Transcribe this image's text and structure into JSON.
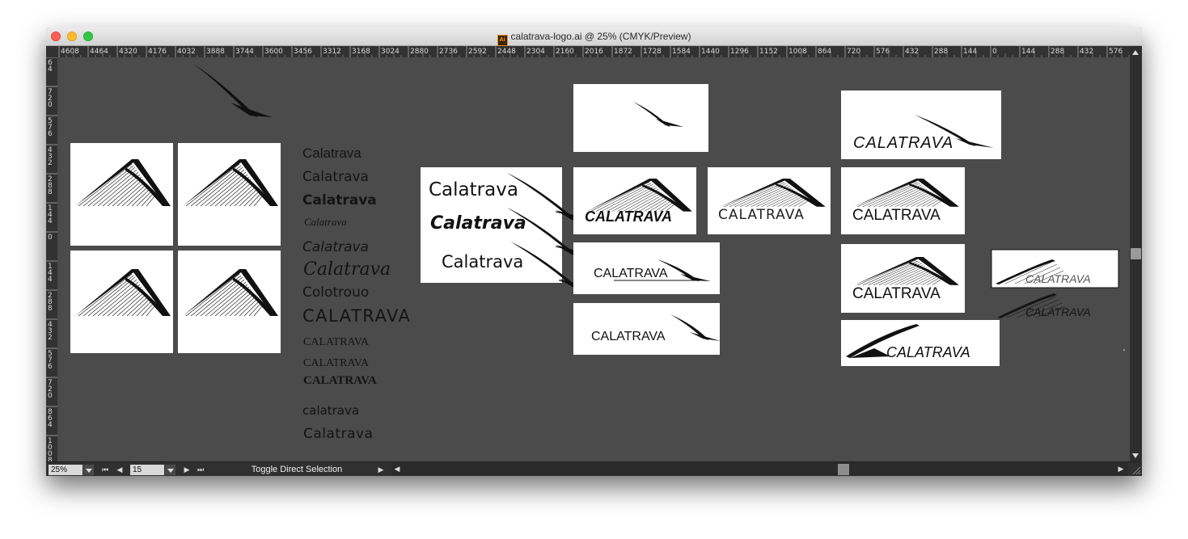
{
  "window": {
    "file_icon_label": "Ai",
    "title": "calatrava-logo.ai @ 25% (CMYK/Preview)"
  },
  "ruler": {
    "h_labels": [
      "4608",
      "4464",
      "4320",
      "4176",
      "4032",
      "3888",
      "3744",
      "3600",
      "3456",
      "3312",
      "3168",
      "3024",
      "2880",
      "2736",
      "2592",
      "2448",
      "2304",
      "2160",
      "2016",
      "1872",
      "1728",
      "1584",
      "1440",
      "1296",
      "1152",
      "1008",
      "864",
      "720",
      "576",
      "432",
      "288",
      "144",
      "0",
      "144",
      "288",
      "432",
      "576"
    ],
    "v_labels": [
      "6\n4",
      "7\n2\n0",
      "5\n7\n6",
      "4\n3\n2",
      "2\n8\n8",
      "1\n4\n4",
      "0",
      "1\n4\n4",
      "2\n8\n8",
      "4\n3\n2",
      "5\n7\n6",
      "7\n2\n0",
      "8\n6\n4",
      "1\n0\n0\n8"
    ]
  },
  "artwork": {
    "font_specimens": [
      "Calatrava",
      "Calatrava",
      "Calatrava",
      "Calatrava",
      "Calatrava",
      "Calatrava",
      "Colotrouo",
      "CALATRAVA",
      "CALATRAVA",
      "CALATRAVA",
      "CALATRAVA",
      "calatrava",
      "Calatrava"
    ],
    "stacked_logos": [
      "Calatrava",
      "Calatrava",
      "Calatrava"
    ],
    "logo_words": {
      "bold_italic_caps": "CALATRAVA",
      "thin_caps": "CALATRAVA",
      "italic_caps_large": "CALATRAVA",
      "underline_caps": "CALATRAVA",
      "plain_caps": "CALATRAVA",
      "caps_middle": "CALATRAVA",
      "caps_right": "CALATRAVA",
      "caps_bottom": "CALATRAVA",
      "small_outlined": "CALATRAVA",
      "small_dark": "CALATRAVA"
    }
  },
  "status_bar": {
    "zoom": "25%",
    "page": "15",
    "label": "Toggle Direct Selection"
  }
}
